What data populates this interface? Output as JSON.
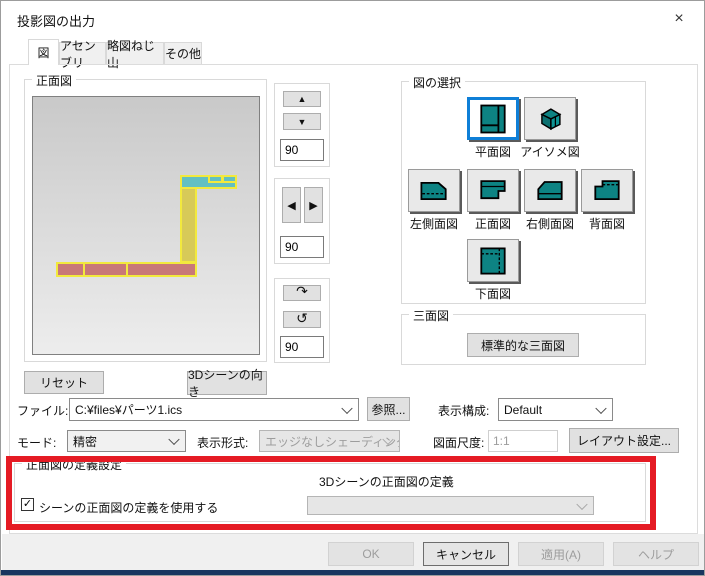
{
  "title": "投影図の出力",
  "tabs": [
    {
      "label": "図"
    },
    {
      "label": "アセンブリ"
    },
    {
      "label": "略図ねじ山"
    },
    {
      "label": "その他"
    }
  ],
  "front_group": {
    "label": "正面図"
  },
  "rotation": {
    "values": [
      "90",
      "90",
      "90"
    ]
  },
  "view_select": {
    "label": "図の選択",
    "views": [
      {
        "label": "平面図"
      },
      {
        "label": "アイソメ図"
      },
      {
        "label": "左側面図"
      },
      {
        "label": "正面図"
      },
      {
        "label": "右側面図"
      },
      {
        "label": "背面図"
      },
      {
        "label": "下面図"
      }
    ]
  },
  "three_view": {
    "label": "三面図",
    "standard_button": "標準的な三面図"
  },
  "actions": {
    "reset": "リセット",
    "scene_orientation": "3Dシーンの向き"
  },
  "file_row": {
    "label": "ファイル:",
    "value": "C:¥files¥パーツ1.ics",
    "browse": "参照...",
    "config_label": "表示構成:",
    "config_value": "Default"
  },
  "mode_row": {
    "mode_label": "モード:",
    "mode_value": "精密",
    "style_label": "表示形式:",
    "style_value": "エッジなしシェーディング",
    "scale_label": "図面尺度:",
    "scale_value": "1:1",
    "layout_button": "レイアウト設定..."
  },
  "definition_group": {
    "label": "正面図の定義設定",
    "checkbox_label": "シーンの正面図の定義を使用する",
    "checked": true,
    "combo_label": "3Dシーンの正面図の定義",
    "combo_value": ""
  },
  "footer": {
    "ok": "OK",
    "cancel": "キャンセル",
    "apply": "適用(A)",
    "help": "ヘルプ"
  },
  "glyphs": {
    "close": "×",
    "up": "▲",
    "down": "▼",
    "left": "◀",
    "right": "▶",
    "rotate_cw": "↷",
    "rotate_ccw": "↺",
    "check": "✓"
  },
  "colors": {
    "accent_blue": "#0f7fd7",
    "teal_icon": "#0d8383",
    "highlight_red": "#e51b24",
    "navy_bar": "#18355f",
    "preview_teal": "#63c0c2",
    "preview_yellow_fill": "#d7ca58",
    "preview_red_fill": "#c87878",
    "preview_outline": "#f2e93d"
  }
}
